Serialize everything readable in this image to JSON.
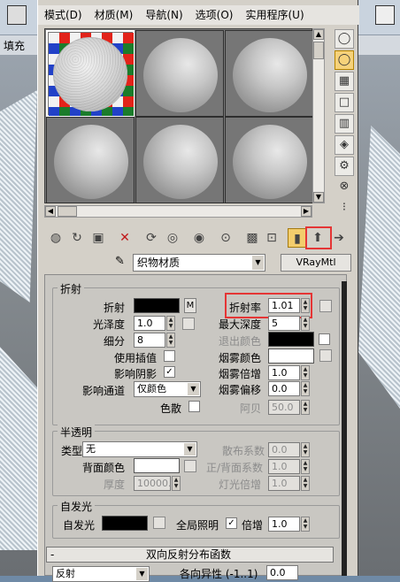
{
  "menu": [
    "模式(D)",
    "材质(M)",
    "导航(N)",
    "选项(O)",
    "实用程序(U)"
  ],
  "background_label": "填充",
  "material": {
    "name": "织物材质",
    "type": "VRayMtl"
  },
  "refraction": {
    "title": "折射",
    "refract_label": "折射",
    "map_button": "M",
    "ior_label": "折射率",
    "ior_value": "1.01",
    "gloss_label": "光泽度",
    "gloss_value": "1.0",
    "maxdepth_label": "最大深度",
    "maxdepth_value": "5",
    "subdivs_label": "细分",
    "subdivs_value": "8",
    "exitcolor_label": "退出颜色",
    "interp_label": "使用插值",
    "fogcolor_label": "烟雾颜色",
    "shadow_label": "影响阴影",
    "shadow_check": "✓",
    "fogmult_label": "烟雾倍增",
    "fogmult_value": "1.0",
    "channel_label": "影响通道",
    "channel_value": "仅颜色",
    "fogbias_label": "烟雾偏移",
    "fogbias_value": "0.0",
    "dispersion_label": "色散",
    "abbe_label": "阿贝",
    "abbe_value": "50.0"
  },
  "translucency": {
    "title": "半透明",
    "type_label": "类型",
    "type_value": "无",
    "scatter_label": "散布系数",
    "scatter_value": "0.0",
    "back_label": "背面颜色",
    "fb_label": "正/背面系数",
    "fb_value": "1.0",
    "thick_label": "厚度",
    "thick_value": "10000.",
    "light_label": "灯光倍增",
    "light_value": "1.0"
  },
  "selfillum": {
    "title": "自发光",
    "label": "自发光",
    "gi_label": "全局照明",
    "gi_check": "✓",
    "mult_label": "倍增",
    "mult_value": "1.0"
  },
  "rollout": {
    "sign": "-",
    "title": "双向反射分布函数",
    "brdf_value": "反射",
    "aniso_label": "各向异性 (-1..1)",
    "aniso_value": "0.0"
  },
  "colors": {
    "accent_highlight": "#e53535",
    "panel": "#d4d0c8"
  }
}
